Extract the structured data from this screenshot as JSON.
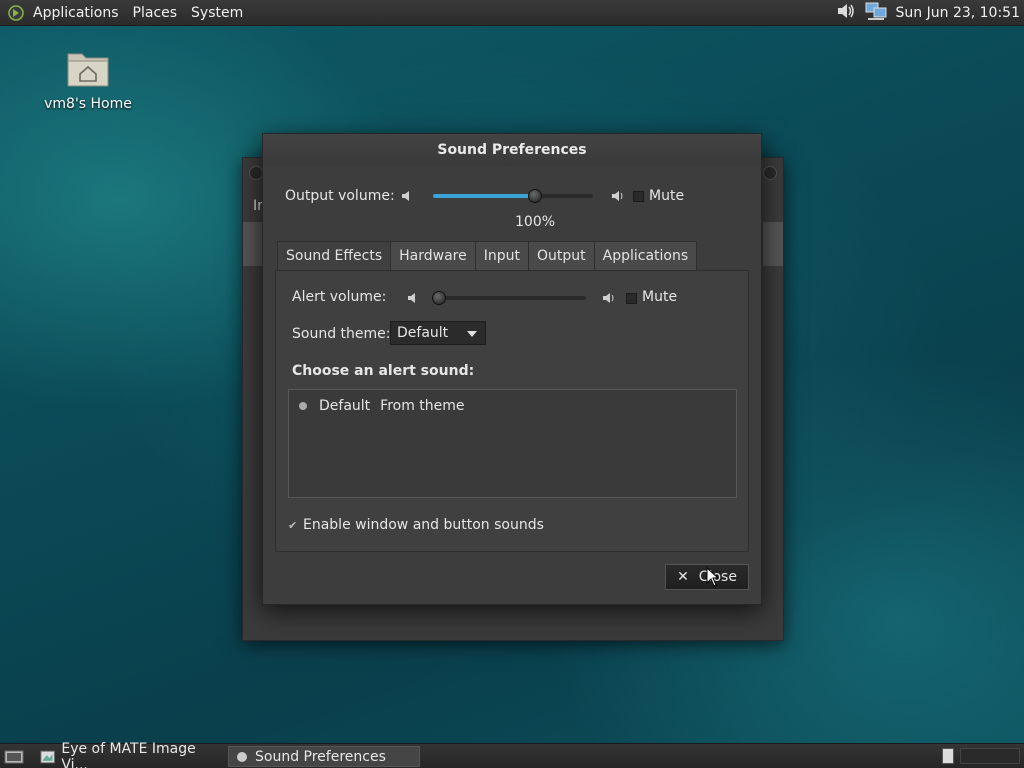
{
  "top_panel": {
    "menus": [
      "Applications",
      "Places",
      "System"
    ],
    "clock": "Sun Jun 23, 10:51"
  },
  "desktop": {
    "home_label": "vm8's Home"
  },
  "bg_window": {
    "fragment": "Ir"
  },
  "dialog": {
    "title": "Sound Preferences",
    "output_label": "Output volume:",
    "output_percent": "100%",
    "output_level": 0.64,
    "mute_label": "Mute",
    "tabs": [
      "Sound Effects",
      "Hardware",
      "Input",
      "Output",
      "Applications"
    ],
    "alert_label": "Alert volume:",
    "alert_level": 0.0,
    "alert_mute_label": "Mute",
    "theme_label": "Sound theme:",
    "theme_value": "Default",
    "choose_label": "Choose an alert sound:",
    "sound_list": [
      {
        "name": "Default",
        "type": "From theme"
      }
    ],
    "enable_sounds_label": "Enable window and button sounds",
    "close_label": "Close"
  },
  "taskbar": {
    "items": [
      "Eye of MATE Image Vi...",
      "Sound Preferences"
    ]
  },
  "colors": {
    "accent": "#3aa3d8",
    "panel": "#2b2b2b",
    "dialog_bg": "#3d3d3d"
  }
}
